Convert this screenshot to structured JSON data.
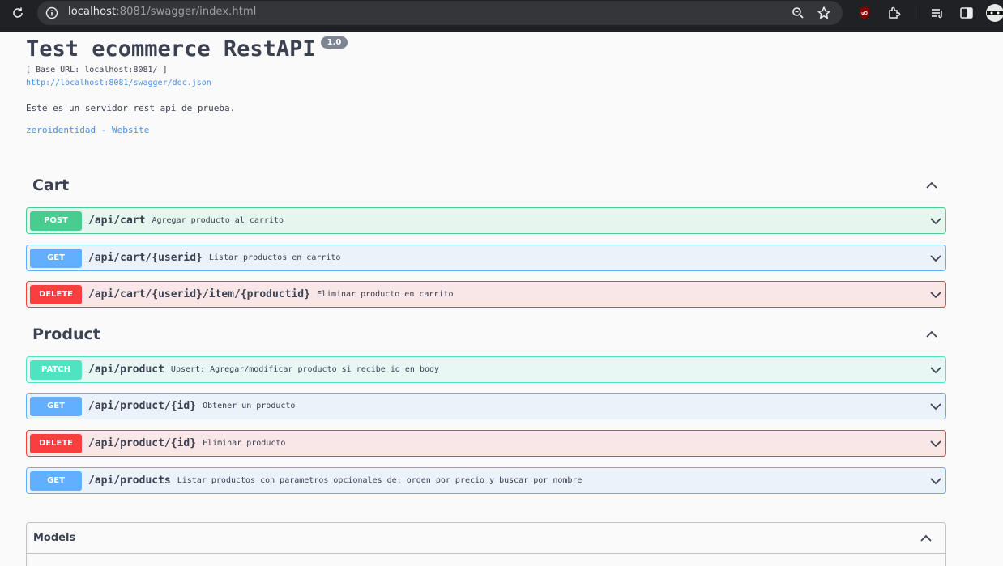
{
  "browser": {
    "url_host": "localhost",
    "url_path": ":8081/swagger/index.html"
  },
  "info": {
    "title": "Test ecommerce RestAPI",
    "version": "1.0",
    "base_url": "[ Base URL: localhost:8081/ ]",
    "doc_link": "http://localhost:8081/swagger/doc.json",
    "description": "Este es un servidor rest api de prueba.",
    "website": "zeroidentidad - Website"
  },
  "tags": [
    {
      "name": "Cart",
      "operations": [
        {
          "method": "POST",
          "path": "/api/cart",
          "summary": "Agregar producto al carrito"
        },
        {
          "method": "GET",
          "path": "/api/cart/{userid}",
          "summary": "Listar productos en carrito"
        },
        {
          "method": "DELETE",
          "path": "/api/cart/{userid}/item/{productid}",
          "summary": "Eliminar producto en carrito"
        }
      ]
    },
    {
      "name": "Product",
      "operations": [
        {
          "method": "PATCH",
          "path": "/api/product",
          "summary": "Upsert: Agregar/modificar producto si recibe id en body"
        },
        {
          "method": "GET",
          "path": "/api/product/{id}",
          "summary": "Obtener un producto"
        },
        {
          "method": "DELETE",
          "path": "/api/product/{id}",
          "summary": "Eliminar producto"
        },
        {
          "method": "GET",
          "path": "/api/products",
          "summary": "Listar productos con parametros opcionales de: orden por precio y buscar por nombre"
        }
      ]
    }
  ],
  "models": {
    "title": "Models"
  },
  "colors": {
    "post": "#49cc90",
    "get": "#61affe",
    "delete": "#f93e3e",
    "patch": "#50e3c2",
    "link": "#4990e2"
  }
}
